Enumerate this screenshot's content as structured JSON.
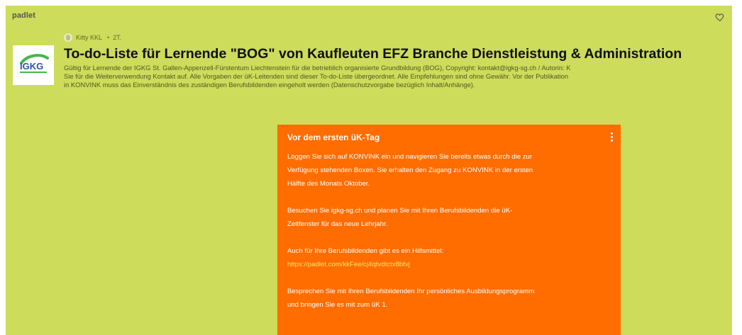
{
  "app": {
    "brand": "padlet"
  },
  "header": {
    "logo_text": "IGKG",
    "author": "Kitty KKL",
    "time": "2T.",
    "title": "To-do-Liste für Lernende \"BOG\" von Kaufleuten EFZ Branche Dienstleistung & Administration",
    "description_lines": [
      "Gültig für Lernende der IGKG St. Gallen-Appenzell-Fürstentum Liechtenstein für die betrieblich organisierte Grundbildung (BOG), Copyright: kontakt@igkg-sg.ch / Autorin: K",
      "Sie für die Weiterverwendung Kontakt auf. Alle Vorgaben der üK-Leitenden sind dieser To-do-Liste übergeordnet. Alle Empfehlungen sind ohne Gewähr. Vor der Publikation",
      "in KONVINK muss das Einverständnis des zuständigen Berufsbildenden eingeholt werden (Datenschutzvorgabe bezüglich Inhalt/Anhänge)."
    ]
  },
  "card": {
    "title": "Vor dem ersten üK-Tag",
    "paragraphs": [
      [
        "Loggen Sie sich auf KONVINK ein und navigieren Sie bereits etwas durch die zur",
        "Verfügung stehenden Boxen. Sie erhalten den Zugang zu KONVINK in der ersten",
        "Hälfte des Monats Oktober."
      ],
      [
        "Besuchen Sie igkg-sg.ch und planen Sie mit Ihren Berufsbildenden die üK-",
        "Zeitfenster für das neue Lehrjahr."
      ],
      [
        "Auch für Ihre Berufsbildenden gibt es ein Hilfsmittel:"
      ],
      [
        "Besprechen Sie mit Ihren Berufsbildenden Ihr persönliches Ausbildungsprogramm",
        "und bringen Sie es mit zum üK 1."
      ]
    ],
    "link": "https://padlet.com/kkFee/cj4qtvdtctx8bfvj"
  },
  "icons": {
    "heart": "heart-outline-icon",
    "menu": "more-vertical-icon",
    "avatar": "user-avatar-icon"
  },
  "colors": {
    "board_background": "#cddc5a",
    "card_background": "#ff6d00",
    "link": "#ffe266",
    "logo_blue": "#2f52a3",
    "logo_green": "#49b549"
  }
}
